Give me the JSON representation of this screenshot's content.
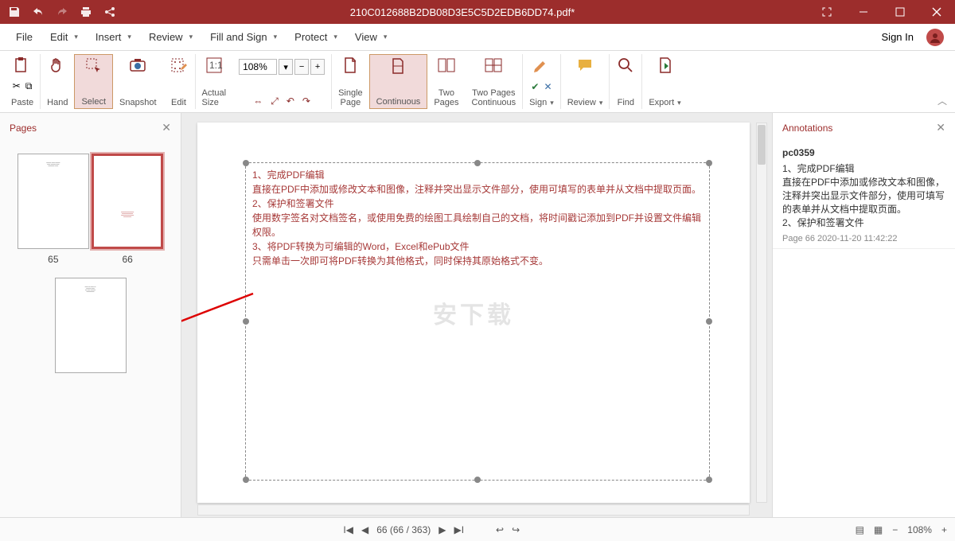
{
  "title": "210C012688B2DB08D3E5C5D2EDB6DD74.pdf*",
  "menus": [
    "File",
    "Edit",
    "Insert",
    "Review",
    "Fill and Sign",
    "Protect",
    "View"
  ],
  "signin": "Sign In",
  "ribbon": {
    "paste": "Paste",
    "hand": "Hand",
    "select": "Select",
    "snapshot": "Snapshot",
    "edit": "Edit",
    "actual": "Actual\nSize",
    "zoom_value": "108%",
    "single": "Single\nPage",
    "continuous": "Continuous",
    "twopages": "Two\nPages",
    "twocont": "Two Pages\nContinuous",
    "sign": "Sign",
    "review": "Review",
    "find": "Find",
    "export": "Export"
  },
  "sidebar": {
    "title": "Pages",
    "thumbs": [
      "65",
      "66",
      ""
    ]
  },
  "textbox_lines": [
    "1、完成PDF编辑",
    "直接在PDF中添加或修改文本和图像，注释并突出显示文件部分，使用可填写的表单并从文档中提取页面。",
    "2、保护和签署文件",
    "使用数字签名对文档签名，或使用免费的绘图工具绘制自己的文档，将时间戳记添加到PDF并设置文件编辑权限。",
    "3、将PDF转换为可编辑的Word，Excel和ePub文件",
    "只需单击一次即可将PDF转换为其他格式，同时保持其原始格式不变。"
  ],
  "watermark": "安下载",
  "annot": {
    "title": "Annotations",
    "author": "pc0359",
    "lines": [
      "1、完成PDF编辑",
      "直接在PDF中添加或修改文本和图像，注释并突出显示文件部分，使用可填写的表单并从文档中提取页面。",
      "2、保护和签署文件"
    ],
    "meta": "Page 66   2020-11-20 11:42:22"
  },
  "status": {
    "pagelabel": "66 (66 / 363)",
    "zoom": "108%"
  }
}
